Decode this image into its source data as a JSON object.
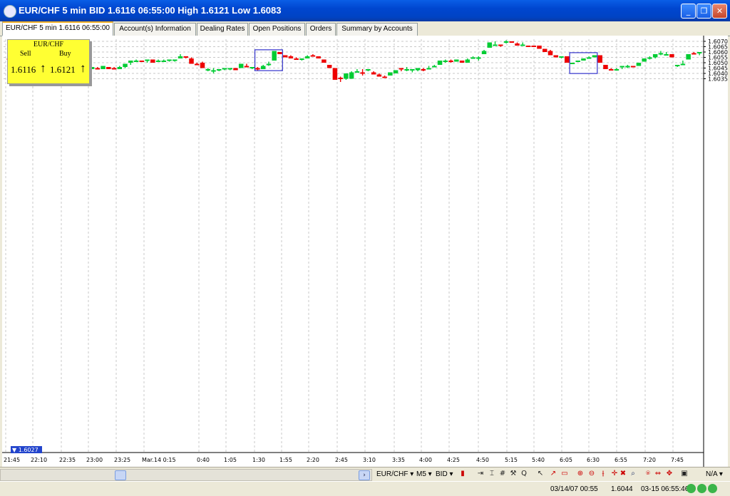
{
  "window": {
    "title": "EUR/CHF 5 min BID 1.6116 06:55:00 High 1.6121 Low 1.6083"
  },
  "tabs": [
    "EUR/CHF 5 min 1.6116 06:55:00",
    "Account(s) Information",
    "Dealing Rates",
    "Open Positions",
    "Orders",
    "Summary by Accounts"
  ],
  "quote": {
    "symbol": "EUR/CHF",
    "sell_label": "Sell",
    "buy_label": "Buy",
    "sell": "1.6116",
    "buy": "1.6121"
  },
  "price_axis": [
    "1.6070",
    "1.6065",
    "1.6060",
    "1.6055",
    "1.6050",
    "1.6045",
    "1.6040",
    "1.6035"
  ],
  "time_axis": [
    "21:45",
    "22:10",
    "22:35",
    "23:00",
    "23:25",
    "Mar.14 0:15",
    "0:40",
    "1:05",
    "1:30",
    "1:55",
    "2:20",
    "2:45",
    "3:10",
    "3:35",
    "4:00",
    "4:25",
    "4:50",
    "5:15",
    "5:40",
    "6:05",
    "6:30",
    "6:55",
    "7:20",
    "7:45"
  ],
  "marker": "1.6027",
  "toolbar": {
    "symbol": "EUR/CHF",
    "period": "M5",
    "side": "BID",
    "na": "N/A"
  },
  "status": {
    "time": "03/14/07 00:55",
    "price": "1.6044",
    "date": "03-15 06:55:46"
  },
  "colors": {
    "up": "#00cc33",
    "down": "#ee0000",
    "frame": "#3333cc",
    "quote_bg": "#ffff33"
  },
  "chart_data": {
    "type": "candlestick",
    "ylim": [
      1.6031,
      1.6071
    ],
    "series": [
      {
        "name": "EUR/CHF 5 min",
        "ohlc": [
          [
            1.6054,
            1.6056,
            1.6053,
            1.6053
          ],
          [
            1.6053,
            1.6053,
            1.6051,
            1.6051
          ],
          [
            1.6051,
            1.6051,
            1.6048,
            1.6048
          ],
          [
            1.6048,
            1.605,
            1.6048,
            1.605
          ],
          [
            1.605,
            1.6051,
            1.6046,
            1.6046
          ],
          [
            1.6046,
            1.6046,
            1.6044,
            1.6045
          ],
          [
            1.6045,
            1.6045,
            1.6044,
            1.6044
          ],
          [
            1.6045,
            1.6046,
            1.6044,
            1.6044
          ],
          [
            1.6045,
            1.6045,
            1.6044,
            1.6044
          ],
          [
            1.6043,
            1.6044,
            1.604,
            1.6044
          ],
          [
            1.6044,
            1.6046,
            1.6044,
            1.6046
          ],
          [
            1.6047,
            1.6047,
            1.6044,
            1.6044
          ],
          [
            1.6045,
            1.6045,
            1.6042,
            1.6042
          ],
          [
            1.6045,
            1.6046,
            1.604,
            1.604
          ],
          [
            1.6044,
            1.6046,
            1.6044,
            1.6046
          ],
          [
            1.6044,
            1.6046,
            1.6044,
            1.6046
          ],
          [
            1.6045,
            1.6046,
            1.6044,
            1.6044
          ],
          [
            1.6044,
            1.6047,
            1.6044,
            1.6047
          ],
          [
            1.6046,
            1.6046,
            1.6044,
            1.6044
          ],
          [
            1.6045,
            1.6046,
            1.6044,
            1.6044
          ],
          [
            1.6044,
            1.6047,
            1.6044,
            1.6046
          ],
          [
            1.6046,
            1.6049,
            1.6045,
            1.6049
          ],
          [
            1.605,
            1.6052,
            1.6048,
            1.6052
          ],
          [
            1.6052,
            1.6053,
            1.6051,
            1.6052
          ],
          [
            1.6052,
            1.6052,
            1.6051,
            1.6051
          ],
          [
            1.6052,
            1.6053,
            1.605,
            1.6053
          ],
          [
            1.6053,
            1.6053,
            1.605,
            1.605
          ],
          [
            1.6052,
            1.6053,
            1.6052,
            1.6052
          ],
          [
            1.6052,
            1.6053,
            1.6052,
            1.6052
          ],
          [
            1.6052,
            1.6053,
            1.6051,
            1.6053
          ],
          [
            1.6052,
            1.6053,
            1.6051,
            1.6053
          ],
          [
            1.6054,
            1.6058,
            1.6054,
            1.6056
          ],
          [
            1.6056,
            1.6056,
            1.6054,
            1.6055
          ],
          [
            1.6054,
            1.6055,
            1.6049,
            1.6049
          ],
          [
            1.6049,
            1.605,
            1.6048,
            1.6048
          ],
          [
            1.605,
            1.6051,
            1.6045,
            1.6045
          ],
          [
            1.6043,
            1.6045,
            1.6042,
            1.6044
          ],
          [
            1.6043,
            1.6045,
            1.604,
            1.6043
          ],
          [
            1.6043,
            1.6044,
            1.6042,
            1.6044
          ],
          [
            1.6044,
            1.6045,
            1.6043,
            1.6045
          ],
          [
            1.6044,
            1.6045,
            1.6043,
            1.6045
          ],
          [
            1.6045,
            1.6045,
            1.6043,
            1.6043
          ],
          [
            1.6045,
            1.6049,
            1.6045,
            1.6049
          ],
          [
            1.6047,
            1.6049,
            1.6046,
            1.6046
          ],
          [
            1.6045,
            1.6046,
            1.6044,
            1.6046
          ],
          [
            1.6045,
            1.6046,
            1.6043,
            1.6044
          ],
          [
            1.6044,
            1.6048,
            1.6044,
            1.6047
          ],
          [
            1.6048,
            1.6051,
            1.6047,
            1.6049
          ],
          [
            1.6052,
            1.6061,
            1.6052,
            1.6061
          ],
          [
            1.606,
            1.606,
            1.6058,
            1.6058
          ],
          [
            1.6057,
            1.6057,
            1.6055,
            1.6055
          ],
          [
            1.6056,
            1.6057,
            1.6054,
            1.6054
          ],
          [
            1.6054,
            1.6055,
            1.6053,
            1.6053
          ],
          [
            1.6053,
            1.6054,
            1.6052,
            1.6054
          ],
          [
            1.6054,
            1.6057,
            1.6054,
            1.6056
          ],
          [
            1.6057,
            1.6058,
            1.6056,
            1.6056
          ],
          [
            1.6056,
            1.6056,
            1.6054,
            1.6054
          ],
          [
            1.6053,
            1.6053,
            1.605,
            1.605
          ],
          [
            1.6048,
            1.6048,
            1.6045,
            1.6045
          ],
          [
            1.6045,
            1.6045,
            1.6034,
            1.6034
          ],
          [
            1.6036,
            1.6037,
            1.6032,
            1.6035
          ],
          [
            1.6035,
            1.604,
            1.6034,
            1.604
          ],
          [
            1.6035,
            1.6042,
            1.6035,
            1.6041
          ],
          [
            1.6042,
            1.6044,
            1.6041,
            1.6042
          ],
          [
            1.6041,
            1.6044,
            1.6038,
            1.604
          ],
          [
            1.6043,
            1.6044,
            1.6042,
            1.6044
          ],
          [
            1.6041,
            1.6042,
            1.6039,
            1.6039
          ],
          [
            1.6039,
            1.604,
            1.6037,
            1.6037
          ],
          [
            1.6037,
            1.6038,
            1.6036,
            1.6036
          ],
          [
            1.6038,
            1.6041,
            1.6038,
            1.6041
          ],
          [
            1.604,
            1.6043,
            1.604,
            1.6043
          ],
          [
            1.6045,
            1.6045,
            1.6042,
            1.6044
          ],
          [
            1.6043,
            1.6046,
            1.6042,
            1.6044
          ],
          [
            1.6043,
            1.6044,
            1.6041,
            1.6044
          ],
          [
            1.6043,
            1.6045,
            1.6042,
            1.6045
          ],
          [
            1.6044,
            1.6045,
            1.6042,
            1.6043
          ],
          [
            1.6044,
            1.6047,
            1.6044,
            1.6045
          ],
          [
            1.6046,
            1.6048,
            1.6046,
            1.6047
          ],
          [
            1.6048,
            1.6052,
            1.6048,
            1.6052
          ],
          [
            1.6051,
            1.6053,
            1.605,
            1.6052
          ],
          [
            1.6052,
            1.6053,
            1.605,
            1.6051
          ],
          [
            1.6051,
            1.6053,
            1.6051,
            1.6053
          ],
          [
            1.6052,
            1.6052,
            1.605,
            1.605
          ],
          [
            1.605,
            1.6054,
            1.605,
            1.6053
          ],
          [
            1.6054,
            1.6056,
            1.6054,
            1.6055
          ],
          [
            1.6054,
            1.6056,
            1.6052,
            1.6055
          ],
          [
            1.6058,
            1.6062,
            1.6058,
            1.6061
          ],
          [
            1.6064,
            1.6069,
            1.6064,
            1.6069
          ],
          [
            1.6067,
            1.607,
            1.6066,
            1.6067
          ],
          [
            1.6067,
            1.6067,
            1.6065,
            1.6066
          ],
          [
            1.6069,
            1.6071,
            1.6068,
            1.607
          ],
          [
            1.607,
            1.607,
            1.6069,
            1.6069
          ],
          [
            1.6068,
            1.6069,
            1.6066,
            1.6066
          ],
          [
            1.6067,
            1.6069,
            1.6066,
            1.6067
          ],
          [
            1.6066,
            1.6066,
            1.6065,
            1.6065
          ],
          [
            1.6066,
            1.6066,
            1.6065,
            1.6065
          ],
          [
            1.6066,
            1.6066,
            1.6063,
            1.6063
          ],
          [
            1.6063,
            1.6063,
            1.606,
            1.606
          ],
          [
            1.6061,
            1.6062,
            1.6057,
            1.6057
          ],
          [
            1.6057,
            1.6057,
            1.6055,
            1.6055
          ],
          [
            1.6055,
            1.6056,
            1.6054,
            1.6056
          ],
          [
            1.6056,
            1.6056,
            1.605,
            1.605
          ],
          [
            1.605,
            1.605,
            1.6049,
            1.605
          ],
          [
            1.6051,
            1.6052,
            1.6051,
            1.6052
          ],
          [
            1.6052,
            1.6054,
            1.6052,
            1.6054
          ],
          [
            1.6054,
            1.6056,
            1.6054,
            1.6055
          ],
          [
            1.6055,
            1.6057,
            1.6055,
            1.6057
          ],
          [
            1.6057,
            1.6057,
            1.605,
            1.605
          ],
          [
            1.6048,
            1.6048,
            1.6044,
            1.6044
          ],
          [
            1.6044,
            1.6045,
            1.6043,
            1.6043
          ],
          [
            1.6043,
            1.6045,
            1.6043,
            1.6044
          ],
          [
            1.6046,
            1.6047,
            1.6044,
            1.6047
          ],
          [
            1.6047,
            1.6048,
            1.6045,
            1.6047
          ],
          [
            1.6047,
            1.6047,
            1.6046,
            1.6046
          ],
          [
            1.6047,
            1.605,
            1.6047,
            1.605
          ],
          [
            1.6051,
            1.6054,
            1.6051,
            1.6054
          ],
          [
            1.6054,
            1.6056,
            1.6053,
            1.6055
          ],
          [
            1.6055,
            1.6057,
            1.6054,
            1.6058
          ],
          [
            1.6059,
            1.6061,
            1.6057,
            1.6059
          ],
          [
            1.6058,
            1.606,
            1.6057,
            1.6058
          ],
          [
            1.6058,
            1.6058,
            1.6055,
            1.6055
          ],
          [
            1.6047,
            1.6048,
            1.6046,
            1.6048
          ],
          [
            1.6049,
            1.6052,
            1.6048,
            1.6049
          ],
          [
            1.6053,
            1.6058,
            1.6053,
            1.6058
          ],
          [
            1.6059,
            1.606,
            1.6058,
            1.6058
          ],
          [
            1.6059,
            1.606,
            1.6057,
            1.606
          ]
        ]
      }
    ]
  }
}
